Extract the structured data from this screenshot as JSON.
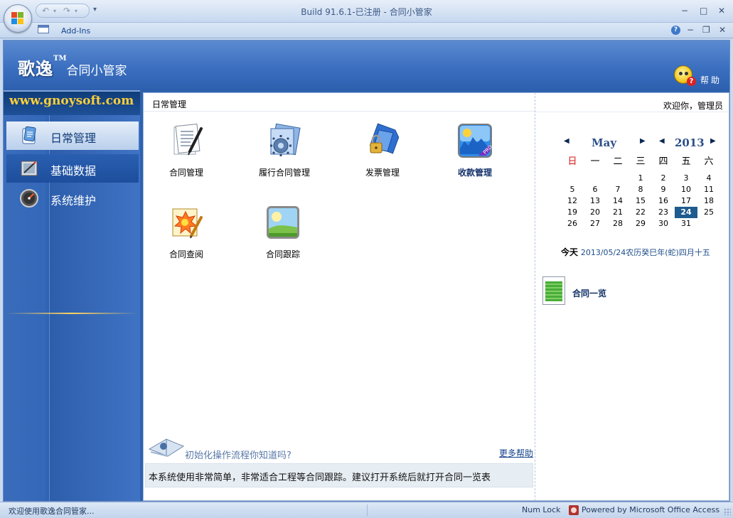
{
  "titlebar": {
    "title": "Build 91.6.1-已注册 - 合同小管家",
    "qat_more": "▾",
    "undo": "↶",
    "redo": "↷",
    "minimize": "−",
    "maximize": "□",
    "close": "✕"
  },
  "ribbon": {
    "addins": "Add-Ins",
    "help": "?",
    "minimize": "−",
    "restore": "❐",
    "close": "✕"
  },
  "header": {
    "brand_main": "歌逸",
    "brand_tm": "TM",
    "brand_sub": "合同小管家",
    "help_label": "帮助"
  },
  "nav": {
    "site": "www.gnoysoft.com",
    "items": [
      {
        "label": "日常管理",
        "icon": "daily-management-icon",
        "state": "active"
      },
      {
        "label": "基础数据",
        "icon": "basic-data-icon",
        "state": "hover"
      },
      {
        "label": "系统维护",
        "icon": "system-maintenance-icon",
        "state": "normal"
      }
    ]
  },
  "center": {
    "title": "日常管理",
    "tiles": [
      {
        "label": "合同管理",
        "icon": "contract-document-icon"
      },
      {
        "label": "履行合同管理",
        "icon": "gear-document-icon"
      },
      {
        "label": "发票管理",
        "icon": "lock-folder-icon"
      },
      {
        "label": "收款管理",
        "icon": "pro-landscape-icon",
        "bold": true
      },
      {
        "label": "合同查阅",
        "icon": "burst-document-icon"
      },
      {
        "label": "合同跟踪",
        "icon": "landscape-icon"
      }
    ],
    "tip": {
      "question": "初始化操作流程你知道吗?",
      "more_link": "更多帮助",
      "text": "本系统使用非常简单，非常适合工程等合同跟踪。建议打开系统后就打开合同一览表"
    }
  },
  "right": {
    "welcome": "欢迎你，管理员",
    "calendar": {
      "month": "May",
      "year": "2013",
      "prev": "◀",
      "next": "▶",
      "weekdays": [
        "日",
        "一",
        "二",
        "三",
        "四",
        "五",
        "六"
      ],
      "weeks": [
        [
          "",
          "",
          "",
          "1",
          "2",
          "3",
          "4"
        ],
        [
          "5",
          "6",
          "7",
          "8",
          "9",
          "10",
          "11"
        ],
        [
          "12",
          "13",
          "14",
          "15",
          "16",
          "17",
          "18"
        ],
        [
          "19",
          "20",
          "21",
          "22",
          "23",
          "24",
          "25"
        ],
        [
          "26",
          "27",
          "28",
          "29",
          "30",
          "31",
          ""
        ]
      ],
      "selected": "24"
    },
    "today_label": "今天",
    "today_value": "2013/05/24农历癸巳年(蛇)四月十五",
    "contract_list": "合同一览"
  },
  "status": {
    "left": "欢迎使用歌逸合同管家...",
    "num_lock": "Num Lock",
    "powered": "Powered by Microsoft Office Access"
  },
  "colors": {
    "header_blue": "#3b6fc0",
    "selected_day": "#1e5b8f",
    "sunday": "#dd1111",
    "site_gold": "#ffcf3a"
  }
}
